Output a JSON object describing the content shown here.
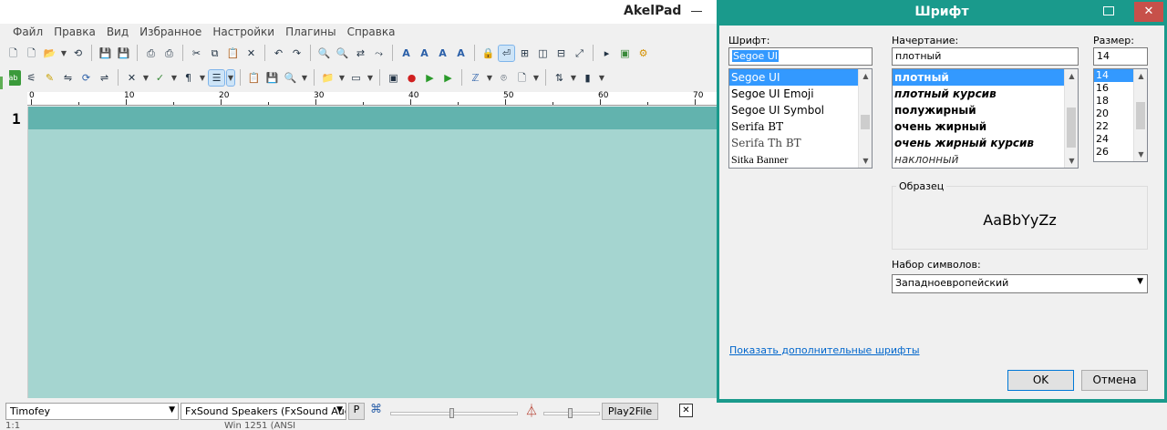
{
  "app": {
    "title": "AkelPad",
    "menu": [
      "Файл",
      "Правка",
      "Вид",
      "Избранное",
      "Настройки",
      "Плагины",
      "Справка"
    ],
    "ruler_ticks": [
      "0",
      "10",
      "20",
      "30",
      "40",
      "50",
      "60",
      "70"
    ],
    "line_number": "1",
    "editor_bg": "#a5d5d0",
    "current_line_bg": "#62b3ae"
  },
  "statusbar": {
    "voice": "Timofey",
    "device": "FxSound Speakers (FxSound Audio",
    "p_button": "P",
    "play_button": "Play2File",
    "close_button": "✕",
    "bottom_text": "1:1",
    "bottom_text2": "Win 1251 (ANSI"
  },
  "dialog": {
    "title": "Шрифт",
    "font_label": "Шрифт:",
    "font_value": "Segoe UI",
    "font_list": [
      "Segoe UI",
      "Segoe UI Emoji",
      "Segoe UI Symbol",
      "Serifa BT",
      "Serifa Th BT",
      "Sitka Banner"
    ],
    "font_selected": 0,
    "style_label": "Начертание:",
    "style_value": "плотный",
    "style_list": [
      "плотный",
      "плотный курсив",
      "полужирный",
      "очень жирный",
      "очень жирный курсив",
      "наклонный"
    ],
    "style_selected": 0,
    "size_label": "Размер:",
    "size_value": "14",
    "size_list": [
      "14",
      "16",
      "18",
      "20",
      "22",
      "24",
      "26"
    ],
    "size_selected": 0,
    "sample_label": "Образец",
    "sample_text": "AaBbYyZz",
    "charset_label": "Набор символов:",
    "charset_value": "Западноевропейский",
    "more_fonts_link": "Показать дополнительные шрифты",
    "ok": "OK",
    "cancel": "Отмена",
    "accent": "#1a9a8c"
  }
}
